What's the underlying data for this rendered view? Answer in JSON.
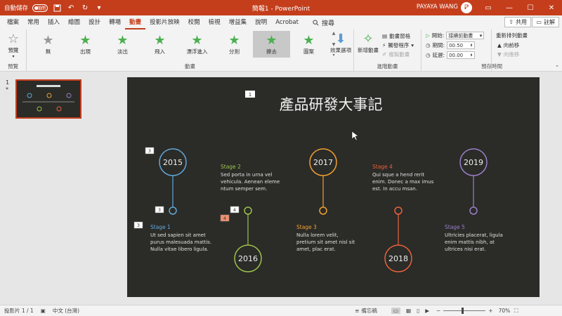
{
  "titlebar": {
    "autosave_label": "自動儲存",
    "autosave_state": "關閉",
    "doc_title": "簡報1 - PowerPoint",
    "user_name": "PAYAYA WANG",
    "user_initial": "P"
  },
  "tabs": [
    "檔案",
    "常用",
    "插入",
    "繪圖",
    "設計",
    "轉場",
    "動畫",
    "投影片放映",
    "校閱",
    "檢視",
    "增益集",
    "說明",
    "Acrobat"
  ],
  "active_tab": "動畫",
  "search_label": "搜尋",
  "share_label": "共用",
  "comment_label": "註解",
  "ribbon": {
    "preview_label": "預覽",
    "preview_group": "預覽",
    "animation_group": "動畫",
    "gallery": [
      "無",
      "出現",
      "淡出",
      "飛入",
      "漂浮進入",
      "分割",
      "擦去",
      "圖案"
    ],
    "selected_effect": "擦去",
    "effect_options": "效果選項",
    "add_animation": "新增動畫",
    "animation_pane": "動畫窗格",
    "trigger": "觸發程序",
    "animation_painter": "複製動畫",
    "advanced_group": "進階動畫",
    "start_label": "開始:",
    "start_value": "接續前動畫",
    "duration_label": "期間:",
    "duration_value": "00.50",
    "delay_label": "延遲:",
    "delay_value": "00.00",
    "timing_group": "預存時間",
    "reorder_label": "重新排列動畫",
    "move_earlier": "向前移",
    "move_later": "向後移"
  },
  "thumb": {
    "number": "1",
    "star": "*"
  },
  "slide": {
    "title": "產品研發大事記",
    "title_tag": "1",
    "years": [
      "2015",
      "2016",
      "2017",
      "2018",
      "2019"
    ],
    "stages": [
      {
        "name": "Stage 1",
        "text": [
          "Ut sed sapien sit amet",
          "purus malesuada mattis.",
          "Nulla vitae libero ligula."
        ],
        "color": "#5fa8d8"
      },
      {
        "name": "Stage 2",
        "text": [
          "Sed porta in urna vel",
          "vehicula. Aenean eleme",
          "ntum semper sem."
        ],
        "color": "#9cc24a"
      },
      {
        "name": "Stage 3",
        "text": [
          "Nulla lorem velit,",
          "pretium sit amet nisl sit",
          "amet, plac erat."
        ],
        "color": "#f0a030"
      },
      {
        "name": "Stage 4",
        "text": [
          "Qui sque a hend rerit",
          "enim. Donec a max imus",
          "est. In accu msan."
        ],
        "color": "#e8623a"
      },
      {
        "name": "Stage 5",
        "text": [
          "Ultricies placerat, ligula",
          "enim mattis nibh, at",
          "ultrices nisi erat."
        ],
        "color": "#9a7fc8"
      }
    ],
    "tags": [
      "3",
      "3",
      "3",
      "4",
      "4",
      "3"
    ]
  },
  "status": {
    "slide_info": "投影片 1 / 1",
    "language": "中文 (台灣)",
    "notes": "備忘稿",
    "zoom": "70%"
  }
}
